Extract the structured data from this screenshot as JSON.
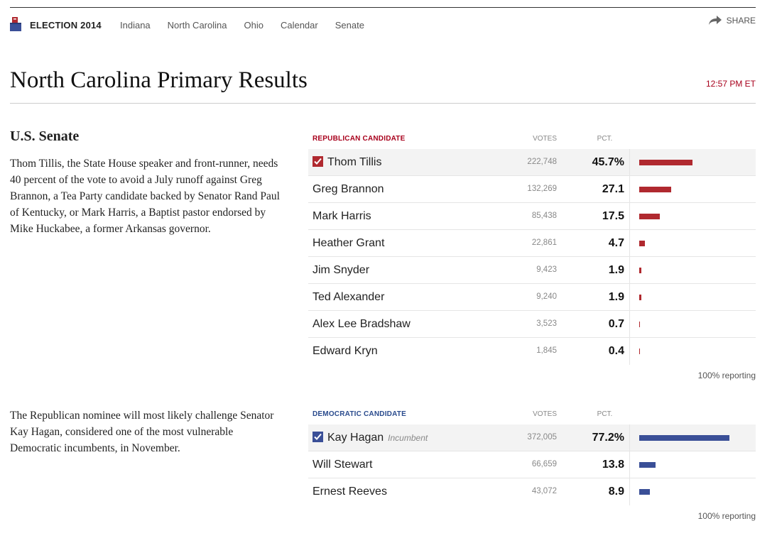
{
  "nav": {
    "brand": "ELECTION 2014",
    "links": [
      "Indiana",
      "North Carolina",
      "Ohio",
      "Calendar",
      "Senate"
    ],
    "share_label": "SHARE"
  },
  "header": {
    "title": "North Carolina Primary Results",
    "timestamp": "12:57 PM ET"
  },
  "senate": {
    "section_title": "U.S. Senate",
    "summary_republican": "Thom Tillis, the State House speaker and front-runner, needs 40 percent of the vote to avoid a July runoff against Greg Brannon, a Tea Party candidate backed by Senator Rand Paul of Kentucky, or Mark Harris, a Baptist pastor endorsed by Mike Huckabee, a former Arkansas governor.",
    "summary_democratic": "The Republican nominee will most likely challenge Senator Kay Hagan, considered one of the most vulnerable Democratic incumbents, in November."
  },
  "republican": {
    "heading": "REPUBLICAN CANDIDATE",
    "votes_label": "VOTES",
    "pct_label": "PCT.",
    "reporting": "100% reporting",
    "candidates": [
      {
        "name": "Thom Tillis",
        "votes": "222,748",
        "pct": "45.7%",
        "pct_value": 45.7,
        "winner": true
      },
      {
        "name": "Greg Brannon",
        "votes": "132,269",
        "pct": "27.1",
        "pct_value": 27.1
      },
      {
        "name": "Mark Harris",
        "votes": "85,438",
        "pct": "17.5",
        "pct_value": 17.5
      },
      {
        "name": "Heather Grant",
        "votes": "22,861",
        "pct": "4.7",
        "pct_value": 4.7
      },
      {
        "name": "Jim Snyder",
        "votes": "9,423",
        "pct": "1.9",
        "pct_value": 1.9
      },
      {
        "name": "Ted Alexander",
        "votes": "9,240",
        "pct": "1.9",
        "pct_value": 1.9
      },
      {
        "name": "Alex Lee Bradshaw",
        "votes": "3,523",
        "pct": "0.7",
        "pct_value": 0.7
      },
      {
        "name": "Edward Kryn",
        "votes": "1,845",
        "pct": "0.4",
        "pct_value": 0.4
      }
    ]
  },
  "democratic": {
    "heading": "DEMOCRATIC CANDIDATE",
    "votes_label": "VOTES",
    "pct_label": "PCT.",
    "reporting": "100% reporting",
    "candidates": [
      {
        "name": "Kay Hagan",
        "tag": "Incumbent",
        "votes": "372,005",
        "pct": "77.2%",
        "pct_value": 77.2,
        "winner": true
      },
      {
        "name": "Will Stewart",
        "votes": "66,659",
        "pct": "13.8",
        "pct_value": 13.8
      },
      {
        "name": "Ernest Reeves",
        "votes": "43,072",
        "pct": "8.9",
        "pct_value": 8.9
      }
    ]
  },
  "colors": {
    "republican": "#b0292f",
    "democratic": "#3a4f97",
    "timestamp": "#a8001c"
  }
}
